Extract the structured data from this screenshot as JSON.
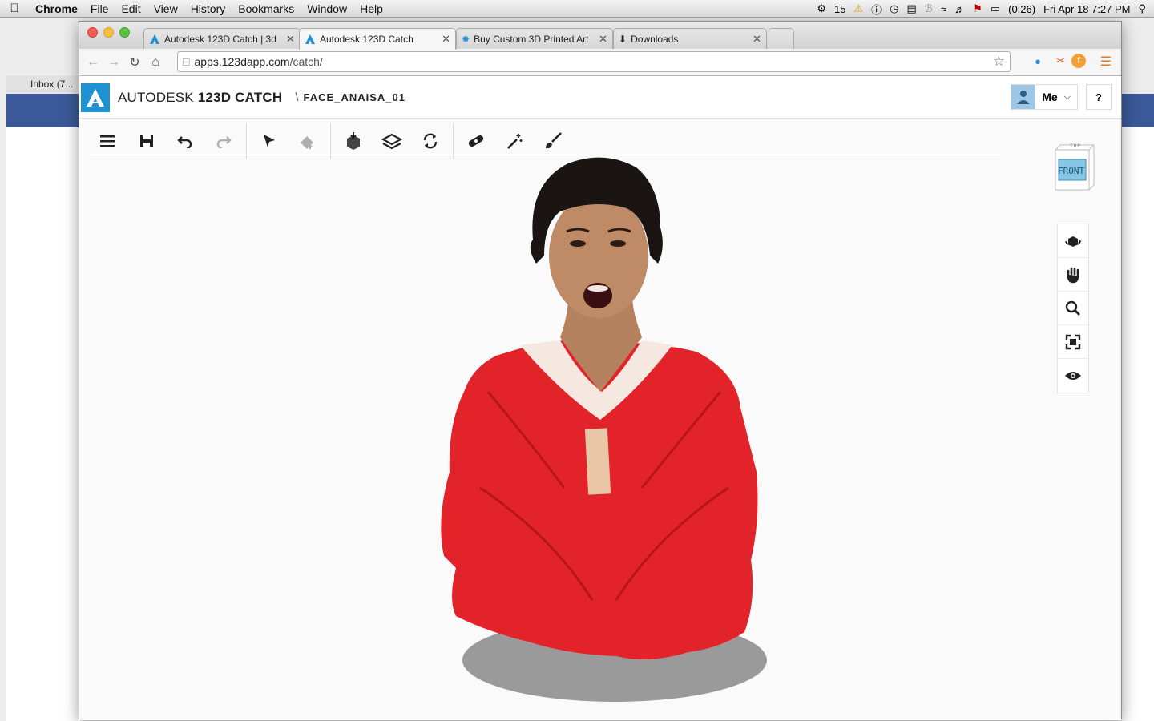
{
  "menubar": {
    "app": "Chrome",
    "items": [
      "File",
      "Edit",
      "View",
      "History",
      "Bookmarks",
      "Window",
      "Help"
    ],
    "status": {
      "notif_count": "15",
      "battery": "(0:26)",
      "clock": "Fri Apr 18  7:27 PM"
    }
  },
  "background_window": {
    "inbox_label": "Inbox (7..."
  },
  "tabs": [
    {
      "title": "Autodesk 123D Catch | 3d",
      "icon": "autodesk-icon"
    },
    {
      "title": "Autodesk 123D Catch",
      "icon": "autodesk-icon"
    },
    {
      "title": "Buy Custom 3D Printed Art",
      "icon": "star-icon"
    },
    {
      "title": "Downloads",
      "icon": "download-icon"
    }
  ],
  "omnibox": {
    "host": "apps.123dapp.com",
    "path": "/catch/"
  },
  "app": {
    "brand_prefix": "AUTODESK",
    "brand_name": "123D",
    "brand_suffix": "CATCH",
    "project_name": "FACE_ANAISA_01",
    "user_label": "Me",
    "help_label": "?"
  },
  "viewcube": {
    "face": "FRONT",
    "top": "TOP"
  },
  "colors": {
    "autodesk_blue": "#1f92d1",
    "sweater_red": "#e3232a",
    "viewcube_face": "#87c7e6"
  }
}
